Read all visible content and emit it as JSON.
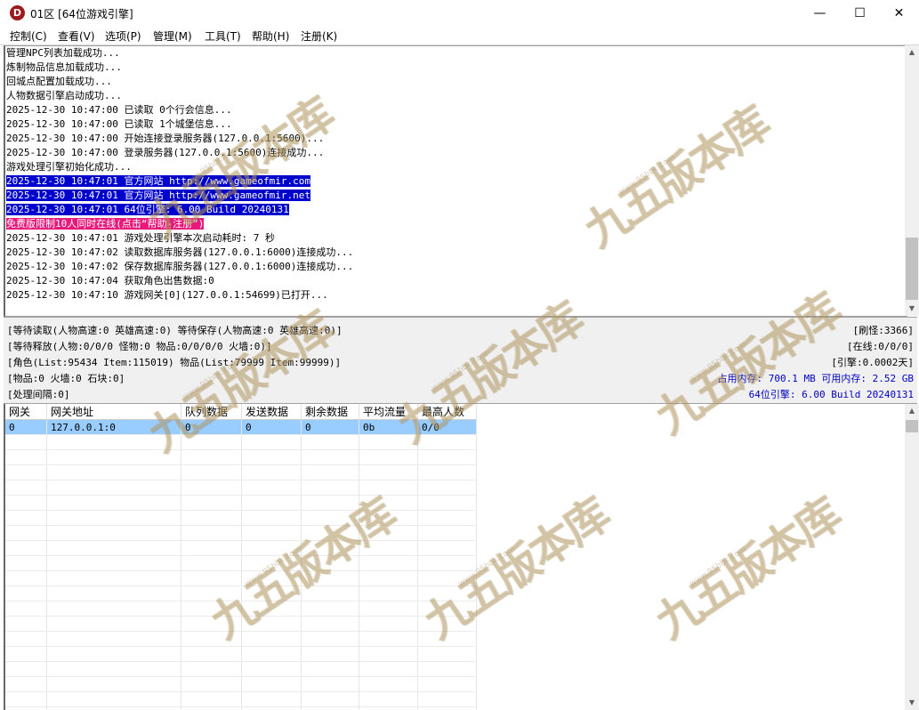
{
  "window": {
    "title": "01区 [64位游戏引擎]",
    "icon_letter": "D",
    "minimize_glyph": "—",
    "maximize_glyph": "☐",
    "close_glyph": "✕"
  },
  "menu": [
    {
      "label": "控制(C)"
    },
    {
      "label": "查看(V)"
    },
    {
      "label": "选项(P)"
    },
    {
      "label": "管理(M)"
    },
    {
      "label": "工具(T)"
    },
    {
      "label": "帮助(H)"
    },
    {
      "label": "注册(K)"
    }
  ],
  "log": [
    {
      "text": "管理NPC列表加载成功...",
      "style": ""
    },
    {
      "text": "炼制物品信息加载成功...",
      "style": ""
    },
    {
      "text": "回城点配置加载成功...",
      "style": ""
    },
    {
      "text": "人物数据引擎启动成功...",
      "style": ""
    },
    {
      "text": "2025-12-30 10:47:00 已读取 0个行会信息...",
      "style": ""
    },
    {
      "text": "2025-12-30 10:47:00 已读取 1个城堡信息...",
      "style": ""
    },
    {
      "text": "2025-12-30 10:47:00 开始连接登录服务器(127.0.0.1:5600)...",
      "style": ""
    },
    {
      "text": "2025-12-30 10:47:00 登录服务器(127.0.0.1:5600)连接成功...",
      "style": ""
    },
    {
      "text": "游戏处理引擎初始化成功...",
      "style": ""
    },
    {
      "text": "2025-12-30 10:47:01 官方网站 http://www.gameofmir.com",
      "style": "blue"
    },
    {
      "text": "2025-12-30 10:47:01 官方网站 http://www.gameofmir.net",
      "style": "blue"
    },
    {
      "text": "2025-12-30 10:47:01 64位引擎: 6.00 Build 20240131",
      "style": "blue"
    },
    {
      "text": "免费版限制10人同时在线(点击“帮助-注册”)",
      "style": "pink"
    },
    {
      "text": "2025-12-30 10:47:01 游戏处理引擎本次启动耗时: 7 秒",
      "style": ""
    },
    {
      "text": "2025-12-30 10:47:02 读取数据库服务器(127.0.0.1:6000)连接成功...",
      "style": ""
    },
    {
      "text": "2025-12-30 10:47:02 保存数据库服务器(127.0.0.1:6000)连接成功...",
      "style": ""
    },
    {
      "text": "2025-12-30 10:47:04 获取角色出售数据:0",
      "style": ""
    },
    {
      "text": "2025-12-30 10:47:10 游戏网关[0](127.0.0.1:54699)已打开...",
      "style": ""
    }
  ],
  "status": {
    "line1": "[等待读取(人物高速:0 英雄高速:0) 等待保存(人物高速:0 英雄高速:0)]",
    "line2": "[等待释放(人物:0/0/0 怪物:0 物品:0/0/0/0 火墙:0)]",
    "line3": "[角色(List:95434 Item:115019) 物品(List:79999 Item:99999)]",
    "line4": "[物品:0 火墙:0 石块:0]",
    "line5": "[处理间隔:0]",
    "refresh": "[刷怪:3366]",
    "online": "[在线:0/0/0]",
    "engine_time": "[引擎:0.0002天]",
    "memory": "占用内存: 700.1 MB 可用内存: 2.52 GB",
    "version": "64位引擎: 6.00 Build 20240131"
  },
  "grid": {
    "columns": [
      "网关",
      "网关地址",
      "队列数据",
      "发送数据",
      "剩余数据",
      "平均流量",
      "最高人数"
    ],
    "rows": [
      [
        "0",
        "127.0.0.1:0",
        "0",
        "0",
        "0",
        "0b",
        "0/0"
      ]
    ]
  },
  "watermark": {
    "text": "九五版本库",
    "sub": "www.95bbk.com"
  }
}
